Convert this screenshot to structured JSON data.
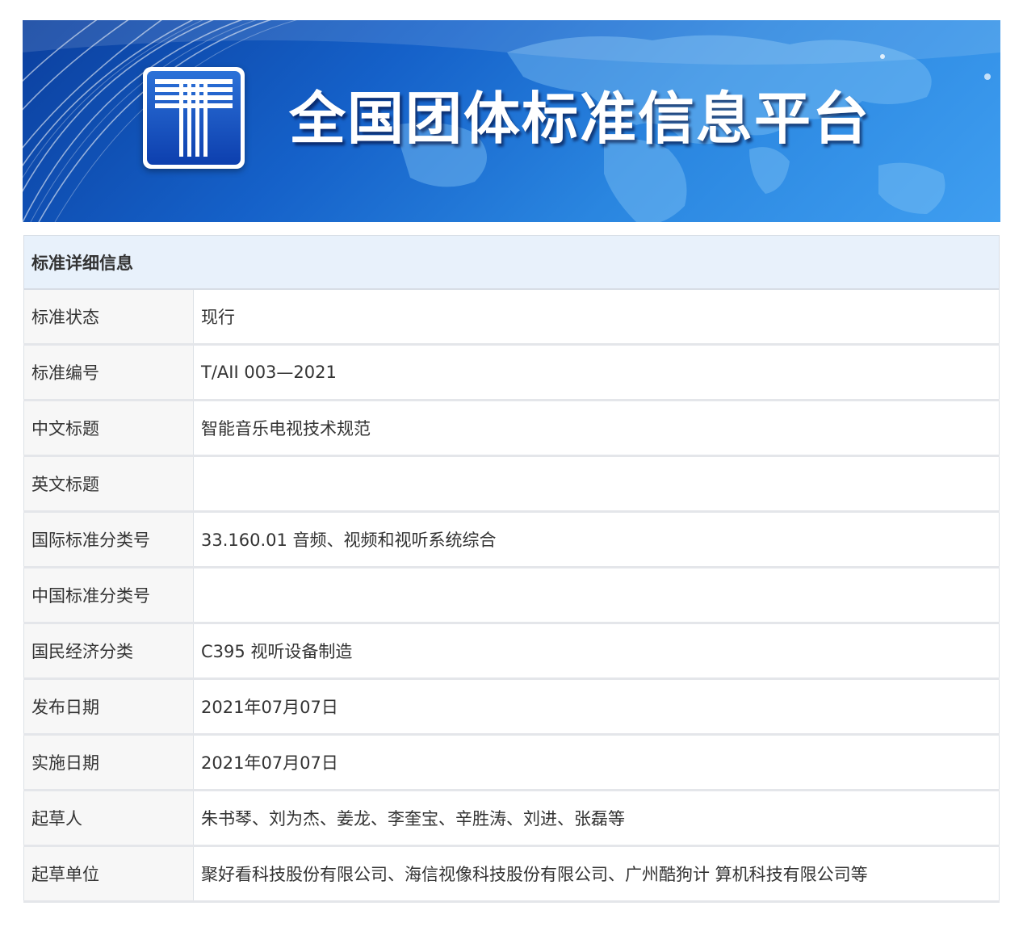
{
  "banner": {
    "title": "全国团体标准信息平台",
    "logo_icon": "standards-t-logo-icon",
    "colors": {
      "banner_dark": "#0b3f9e",
      "banner_light": "#3f9ef0",
      "title": "#ffffff"
    }
  },
  "details": {
    "heading": "标准详细信息",
    "rows": [
      {
        "label": "标准状态",
        "value": "现行"
      },
      {
        "label": "标准编号",
        "value": "T/AII 003—2021"
      },
      {
        "label": "中文标题",
        "value": "智能音乐电视技术规范"
      },
      {
        "label": "英文标题",
        "value": ""
      },
      {
        "label": "国际标准分类号",
        "value": "33.160.01 音频、视频和视听系统综合"
      },
      {
        "label": "中国标准分类号",
        "value": ""
      },
      {
        "label": "国民经济分类",
        "value": "C395 视听设备制造"
      },
      {
        "label": "发布日期",
        "value": "2021年07月07日"
      },
      {
        "label": "实施日期",
        "value": "2021年07月07日"
      },
      {
        "label": "起草人",
        "value": "朱书琴、刘为杰、姜龙、李奎宝、辛胜涛、刘进、张磊等"
      },
      {
        "label": "起草单位",
        "value": "聚好看科技股份有限公司、海信视像科技股份有限公司、广州酷狗计 算机科技有限公司等"
      }
    ],
    "colors": {
      "header_bg": "#e8f1fb",
      "label_bg": "#f7f7f7",
      "border": "#dde1e6",
      "text": "#333333"
    }
  }
}
